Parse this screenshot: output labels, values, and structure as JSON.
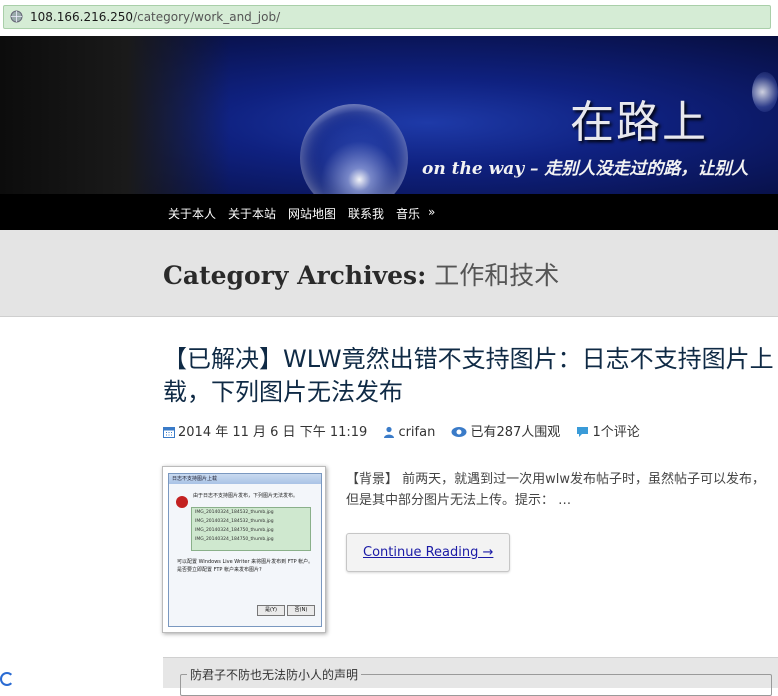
{
  "address_bar": {
    "url_host": "108.166.216.250",
    "url_path": "/category/work_and_job/"
  },
  "header": {
    "site_title": "在路上",
    "tagline": "on the way – 走别人没走过的路，让别人"
  },
  "nav": {
    "items": [
      "关于本人",
      "关于本站",
      "网站地图",
      "联系我",
      "音乐"
    ],
    "more": "»"
  },
  "archive": {
    "label": "Category Archives:",
    "category": "工作和技术"
  },
  "post": {
    "title": "【已解决】WLW竟然出错不支持图片：日志不支持图片上载，下列图片无法发布",
    "date": "2014 年 11 月 6 日 下午 11:19",
    "author": "crifan",
    "views": "已有287人围观",
    "comments": "1个评论",
    "excerpt": "【背景】 前两天，就遇到过一次用wlw发布帖子时，虽然帖子可以发布，但是其中部分图片无法上传。提示： …",
    "read_more": "Continue Reading →",
    "thumbnail": {
      "dialog_title": "日志不支持图片上载",
      "message": "由于日志不支持图片发布，下列图片无法发布。",
      "files": [
        "IMG_20140324_184532_thumb.jpg",
        "IMG_20140324_184532_thumb.jpg",
        "IMG_20140324_184750_thumb.jpg",
        "IMG_20140324_184750_thumb.jpg"
      ],
      "hint_line1": "可以配置 Windows Live Writer 来将图片发布到 FTP 帐户。",
      "hint_line2": "是否要立即配置 FTP 帐户来发布图片?",
      "yes": "是(Y)",
      "no": "否(N)"
    }
  },
  "notice": {
    "label": "防君子不防也无法防小人的声明"
  },
  "colors": {
    "nav_bg": "#000000",
    "archive_bg": "#e4e4e4",
    "title_color": "#0f2a45",
    "link_color": "#1a1aa6",
    "address_bar_bg": "#d5ecd5"
  }
}
